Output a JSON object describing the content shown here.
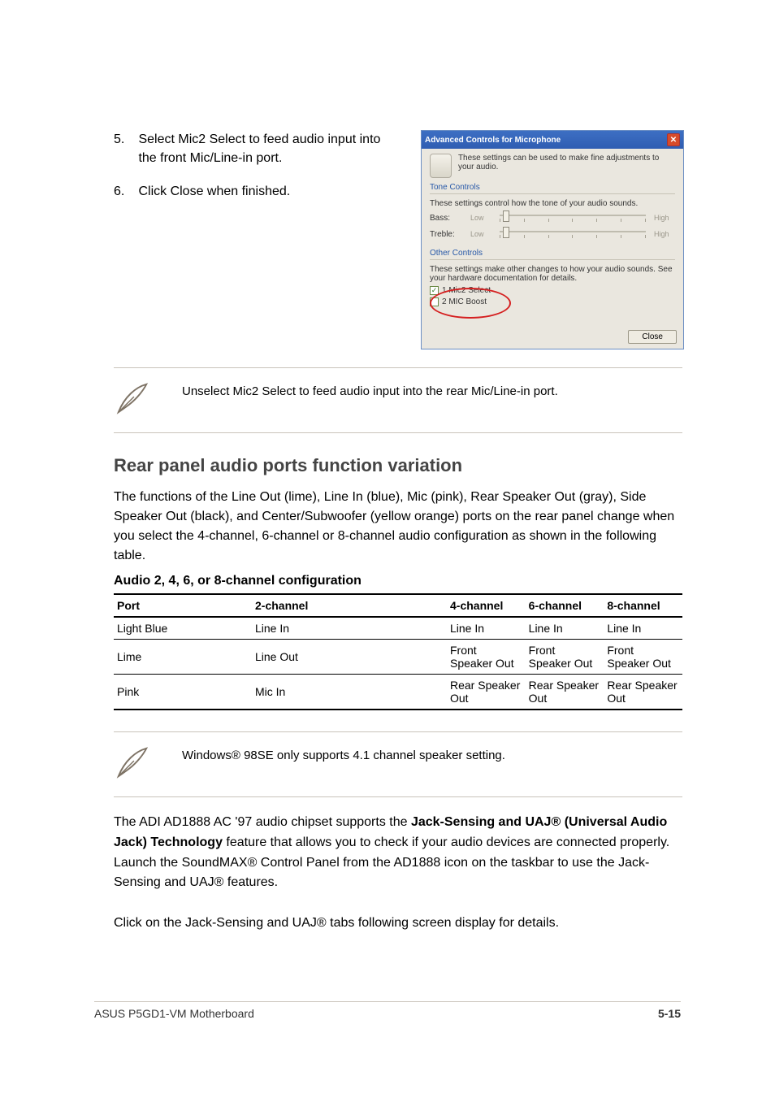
{
  "steps": {
    "s5_num": "5.",
    "s5_text": "Select Mic2 Select to feed audio input into the front Mic/Line-in port.",
    "s6_num": "6.",
    "s6_text": "Click Close when finished."
  },
  "dialog": {
    "title": "Advanced Controls for Microphone",
    "intro": "These settings can be used to make fine adjustments to your audio.",
    "tone_legend": "Tone Controls",
    "tone_desc": "These settings control how the tone of your audio sounds.",
    "bass_label": "Bass:",
    "treble_label": "Treble:",
    "low": "Low",
    "high": "High",
    "other_legend": "Other Controls",
    "other_desc": "These settings make other changes to how your audio sounds. See your hardware documentation for details.",
    "chk1": "1 Mic2 Select",
    "chk2": "2 MIC Boost",
    "close_btn": "Close"
  },
  "note1": "Unselect Mic2 Select to feed audio input into the rear Mic/Line-in port.",
  "section": {
    "heading": "Rear panel audio ports function variation",
    "para": "The functions of the Line Out (lime), Line In (blue), Mic (pink), Rear Speaker Out (gray), Side Speaker Out (black), and Center/Subwoofer (yellow orange) ports on the rear panel change when you select the 4-channel, 6-channel or 8-channel audio configuration as shown in the following table.",
    "table_title": "Audio 2, 4, 6, or 8-channel configuration"
  },
  "table": {
    "headers": [
      "Port",
      "2-channel",
      "4-channel",
      "6-channel",
      "8-channel"
    ],
    "rows": [
      [
        "Light Blue",
        "Line In",
        "Line In",
        "Line In",
        "Line In"
      ],
      [
        "Lime",
        "Line Out",
        "Front Speaker Out",
        "Front Speaker Out",
        "Front Speaker Out"
      ],
      [
        "Pink",
        "Mic In",
        "Rear Speaker Out",
        "Rear Speaker Out",
        "Rear Speaker Out"
      ]
    ]
  },
  "note2": "Windows® 98SE only supports 4.1 channel speaker setting.",
  "para2": {
    "lead": "The ADI AD1888 AC '97 audio chipset supports the ",
    "bold": "Jack-Sensing and UAJ® (Universal Audio Jack) Technology",
    "tail": " feature that allows you to check if your audio devices are connected properly. Launch the SoundMAX® Control Panel from the AD1888 icon on the taskbar to use the Jack-Sensing and UAJ® features.",
    "p3": "Click on the Jack-Sensing and UAJ® tabs following screen display for details."
  },
  "footer": {
    "left": "ASUS P5GD1-VM Motherboard",
    "right": "5-15"
  }
}
